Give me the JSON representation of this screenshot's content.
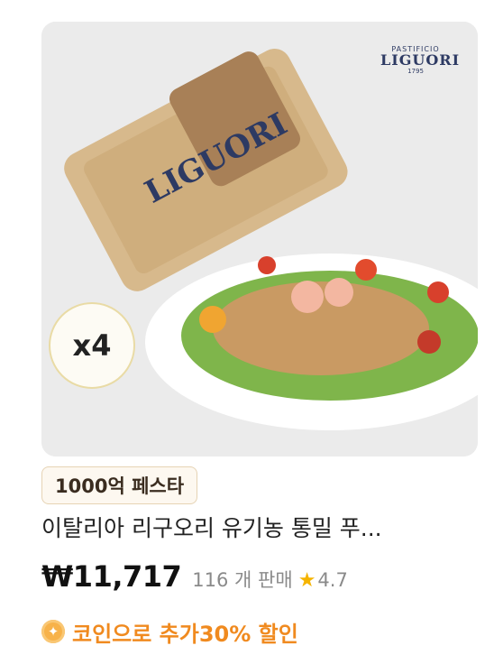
{
  "product": {
    "brand_logo": {
      "small": "PASTIFICIO",
      "name": "LIGUORI",
      "year": "1795"
    },
    "quantity_badge": "x4",
    "promo_tag": "1000억 페스타",
    "title": "이탈리아 리구오리 유기농 통밀 푸...",
    "price": "₩11,717",
    "sold": "116 개 판매",
    "rating": "4.7",
    "coin_offer": "코인으로 추가30% 할인",
    "icons": {
      "rating": "star-icon",
      "coin": "coin-icon"
    },
    "colors": {
      "coin": "#f08a1f",
      "star": "#f5b400",
      "tag_border": "#e6d3b4"
    }
  }
}
